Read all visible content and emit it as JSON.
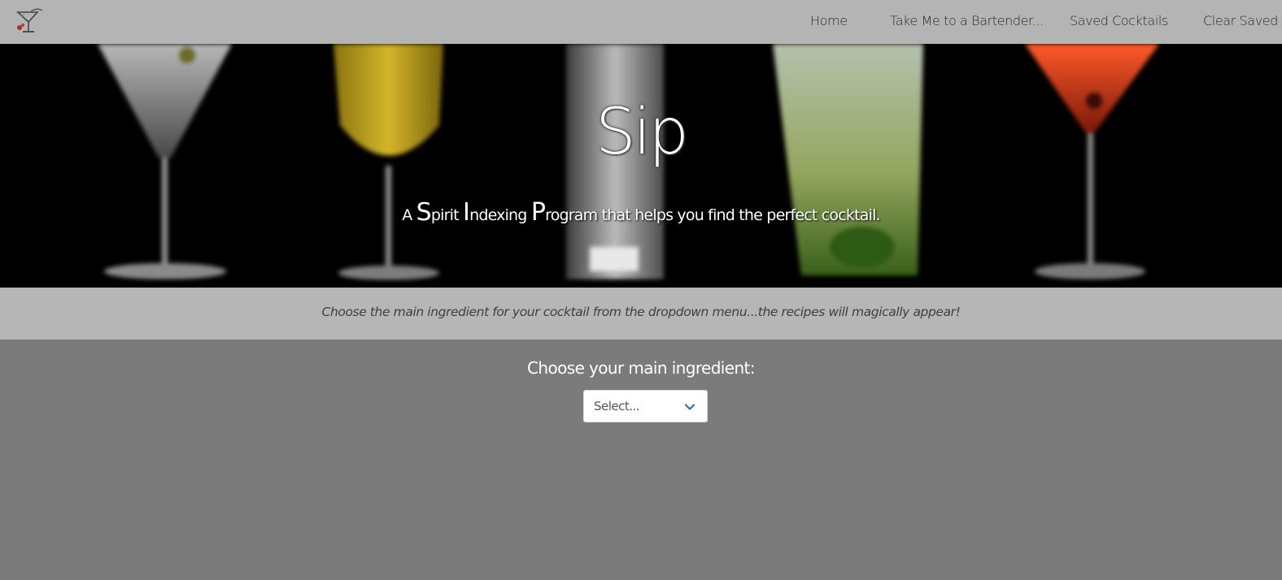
{
  "navbar": {
    "logo_icon": "cocktail-logo-icon",
    "links": {
      "home": "Home",
      "bartender": "Take Me to a Bartender...",
      "saved": "Saved Cocktails",
      "clear": "Clear Saved"
    }
  },
  "hero": {
    "title": "Sip",
    "subtitle_parts": [
      "A ",
      "S",
      "pirit ",
      "I",
      "ndexing ",
      "P",
      "rogram that helps you find the perfect cocktail."
    ]
  },
  "instruction": {
    "text": "Choose the main ingredient for your cocktail from the dropdown menu...the recipes will magically appear!"
  },
  "main": {
    "choose_label": "Choose your main ingredient:",
    "select": {
      "value": "Select...",
      "icon": "chevron-down-icon",
      "accent_color": "#2f6fbf"
    }
  },
  "colors": {
    "navbar_bg": "#b4b4b4",
    "page_bg": "#7b7b7b",
    "band_bg": "#b6b6b6"
  }
}
